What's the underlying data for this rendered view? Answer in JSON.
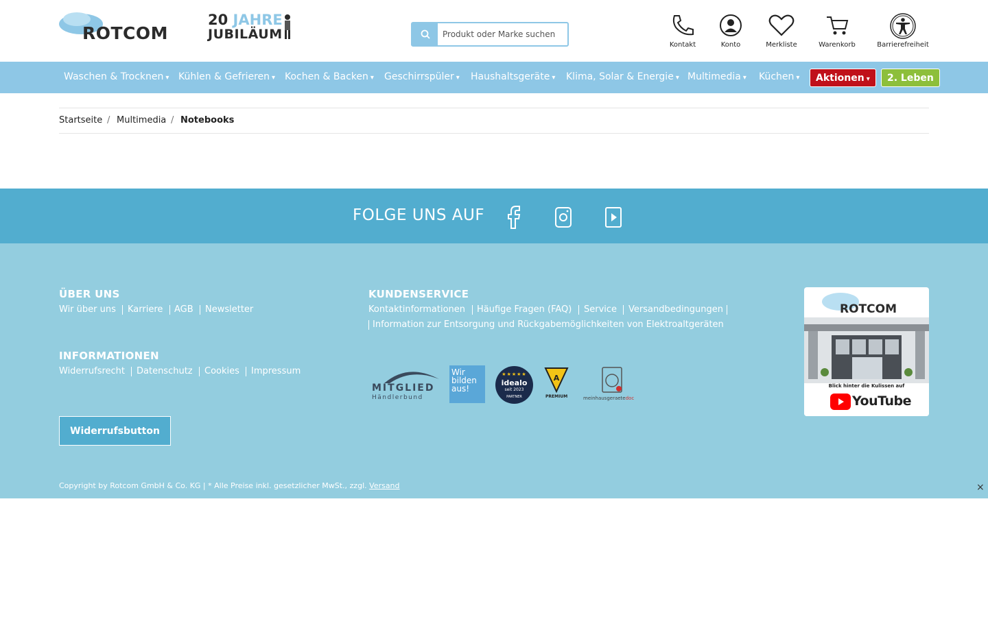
{
  "header": {
    "logo_text": "ROTCOM",
    "jubilaeum_line1_num": "20",
    "jubilaeum_line1_word": "JAHRE",
    "jubilaeum_line2": "JUBILÄUM",
    "search_placeholder": "Produkt oder Marke suchen",
    "icons": [
      {
        "label": "Kontakt",
        "icon": "phone-icon"
      },
      {
        "label": "Konto",
        "icon": "user-icon"
      },
      {
        "label": "Merkliste",
        "icon": "heart-icon"
      },
      {
        "label": "Warenkorb",
        "icon": "cart-icon"
      },
      {
        "label": "Barrierefreiheit",
        "icon": "accessibility-icon"
      }
    ]
  },
  "nav": {
    "items": [
      "Waschen & Trocknen",
      "Kühlen & Gefrieren",
      "Kochen & Backen",
      "Geschirrspüler",
      "Haushaltsgeräte",
      "Klima, Solar & Energie",
      "Multimedia",
      "Küchen"
    ],
    "aktionen": "Aktionen",
    "leben": "2. Leben",
    "caret": "▾"
  },
  "breadcrumb": {
    "items": [
      "Startseite",
      "Multimedia",
      "Notebooks"
    ],
    "separator": "/"
  },
  "follow": {
    "title": "FOLGE UNS AUF",
    "networks": [
      "facebook-icon",
      "instagram-icon",
      "youtube-icon"
    ]
  },
  "footer": {
    "ueber_uns": {
      "title": "ÜBER UNS",
      "links": [
        "Wir über uns",
        "Karriere",
        "AGB",
        "Newsletter"
      ]
    },
    "informationen": {
      "title": "INFORMATIONEN",
      "links": [
        "Widerrufsrecht",
        "Datenschutz",
        "Cookies",
        "Impressum"
      ]
    },
    "kundenservice": {
      "title": "KUNDENSERVICE",
      "links": [
        "Kontaktinformationen",
        "Häufige Fragen (FAQ)",
        "Service",
        "Versandbedingungen"
      ],
      "link_line2": "Information zur Entsorgung und Rückgabemöglichkeiten von Elektroaltgeräten"
    },
    "widerruf_button": "Widerrufsbutton",
    "badges": {
      "mitglied": "MITGLIED",
      "haendlerbund": "Händlerbund",
      "wir_bilden": "Wir bilden aus!",
      "idealo": "idealo",
      "idealo_sub": "seit 2023",
      "idealo_partner": "PARTNER",
      "premium": "PREMIUM",
      "meinhaus": "meinhausgeraete",
      "meinhaus_doc": "doc"
    },
    "youtube_promo": {
      "logo": "ROTCOM",
      "caption": "Blick hinter die Kulissen auf",
      "youtube": "YouTube"
    },
    "copyright": "Copyright by Rotcom GmbH & Co. KG | * Alle Preise inkl. gesetzlicher MwSt., zzgl.",
    "versand": "Versand",
    "close": "×"
  },
  "colors": {
    "brand_light_blue": "#8ec7e6",
    "follow_bar": "#52adcf",
    "footer_bg": "#93cddf",
    "aktionen_red": "#c0101a",
    "leben_green": "#8dbf3b"
  }
}
